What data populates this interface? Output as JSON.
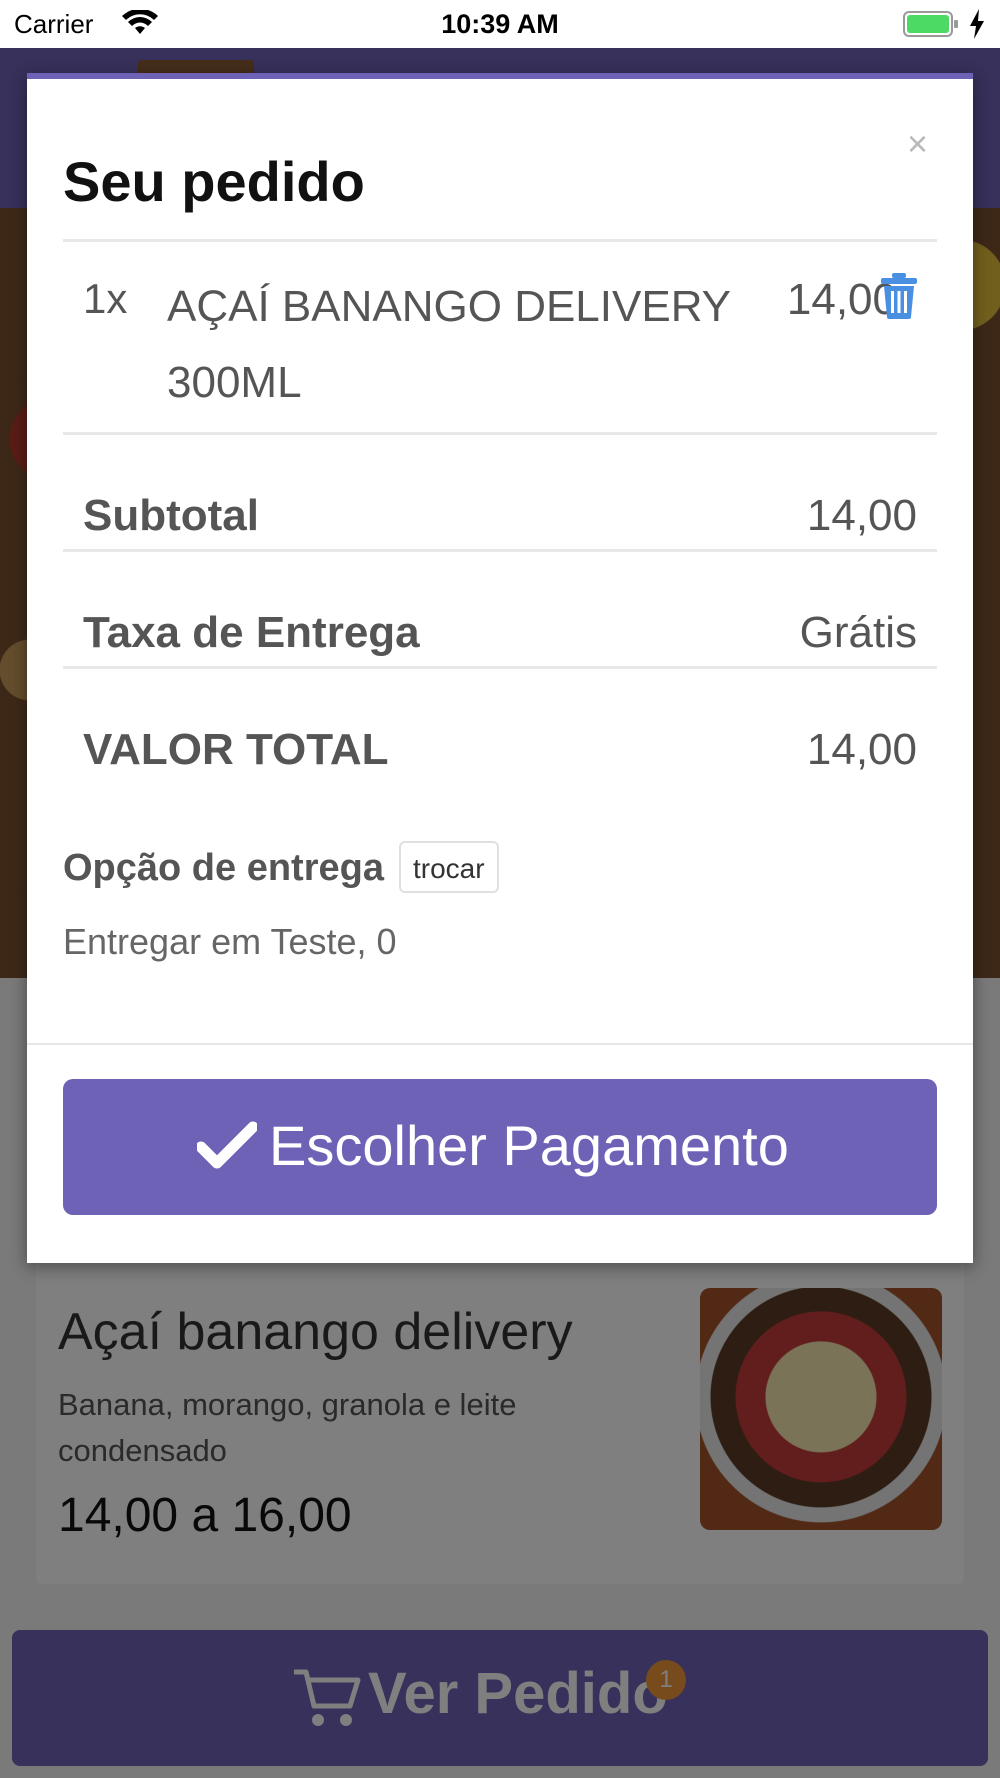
{
  "status_bar": {
    "carrier": "Carrier",
    "time": "10:39 AM"
  },
  "product": {
    "name": "Açaí banango delivery",
    "description": "Banana, morango, granola e leite condensado",
    "price": "14,00 a 16,00"
  },
  "cart_bar": {
    "label": "Ver Pedido",
    "badge_count": "1"
  },
  "modal": {
    "close_label": "×",
    "title": "Seu pedido",
    "item": {
      "qty": "1x",
      "name": "AÇAÍ BANANGO DELIVERY 300ML",
      "price": "14,00"
    },
    "subtotal_label": "Subtotal",
    "subtotal_value": "14,00",
    "fee_label": "Taxa de Entrega",
    "fee_value": "Grátis",
    "total_label": "VALOR TOTAL",
    "total_value": "14,00",
    "delivery_option_label": "Opção de entrega",
    "change_button": "trocar",
    "delivery_address": "Entregar em Teste, 0",
    "pay_button": "Escolher Pagamento"
  },
  "colors": {
    "accent": "#6e62b6",
    "trash_icon": "#4a90e2",
    "badge": "#f0963a"
  }
}
